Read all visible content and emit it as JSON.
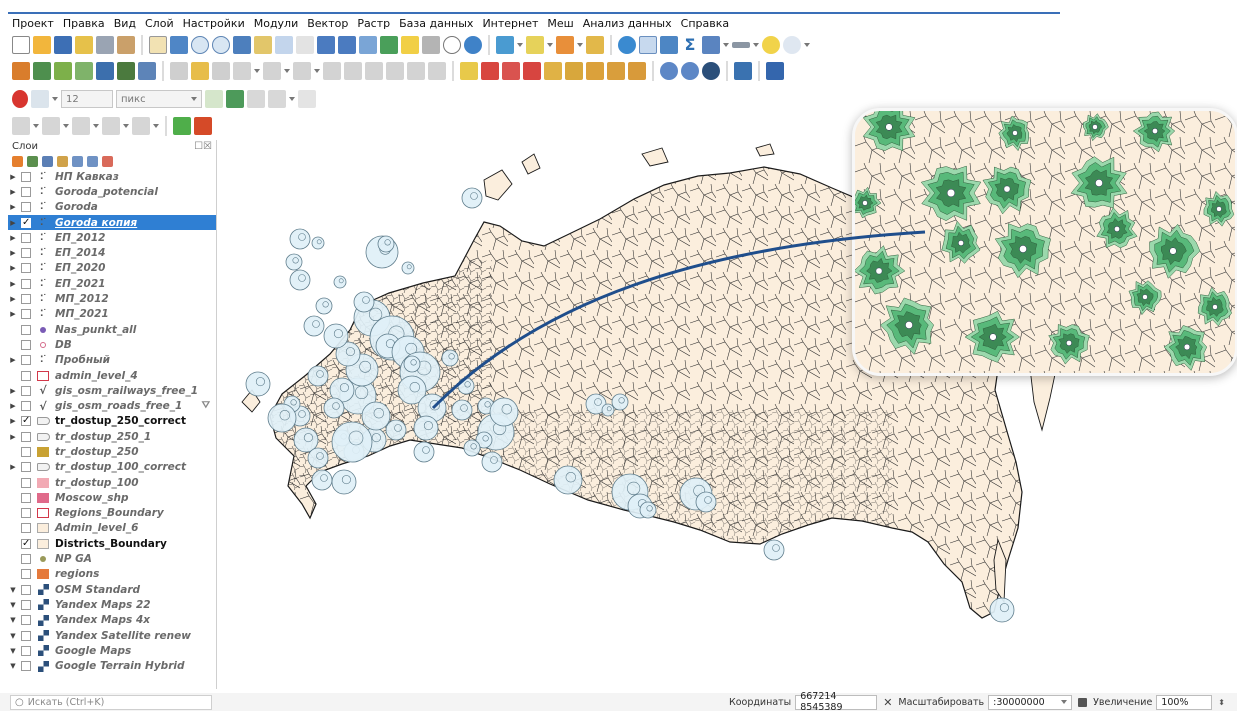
{
  "menu": [
    "Проект",
    "Правка",
    "Вид",
    "Слой",
    "Настройки",
    "Модули",
    "Вектор",
    "Растр",
    "База данных",
    "Интернет",
    "Меш",
    "Анализ данных",
    "Справка"
  ],
  "toolbar": {
    "font_size_value": "12",
    "unit_select": "пикс"
  },
  "layers_panel": {
    "title": "Слои",
    "header_buttons": "☐☒",
    "items": [
      {
        "name": "НП Кавказ",
        "arrow": "▶",
        "check": "",
        "sym": "points",
        "visible": false
      },
      {
        "name": "Goroda_potencial",
        "arrow": "▶",
        "check": "",
        "sym": "points",
        "visible": false
      },
      {
        "name": "Goroda",
        "arrow": "▶",
        "check": "",
        "sym": "points",
        "visible": false
      },
      {
        "name": "Goroda копия",
        "arrow": "▶",
        "check": "✓",
        "sym": "points",
        "visible": true,
        "selected": true
      },
      {
        "name": "ЕП_2012",
        "arrow": "▶",
        "check": "",
        "sym": "points",
        "visible": false
      },
      {
        "name": "ЕП_2014",
        "arrow": "▶",
        "check": "",
        "sym": "points",
        "visible": false
      },
      {
        "name": "ЕП_2020",
        "arrow": "▶",
        "check": "",
        "sym": "points",
        "visible": false
      },
      {
        "name": "ЕП_2021",
        "arrow": "▶",
        "check": "",
        "sym": "points",
        "visible": false
      },
      {
        "name": "МП_2012",
        "arrow": "▶",
        "check": "",
        "sym": "points",
        "visible": false
      },
      {
        "name": "МП_2021",
        "arrow": "▶",
        "check": "",
        "sym": "points",
        "visible": false
      },
      {
        "name": "Nas_punkt_all",
        "arrow": "",
        "check": "",
        "sym": "dot-purple",
        "visible": false
      },
      {
        "name": "DB",
        "arrow": "",
        "check": "",
        "sym": "dot-pink",
        "visible": false
      },
      {
        "name": "Пробный",
        "arrow": "▶",
        "check": "",
        "sym": "points",
        "visible": false
      },
      {
        "name": "admin_level_4",
        "arrow": "",
        "check": "",
        "sym": "box-red-outline",
        "visible": false
      },
      {
        "name": "gis_osm_railways_free_1",
        "arrow": "▶",
        "check": "",
        "sym": "line",
        "visible": false
      },
      {
        "name": "gis_osm_roads_free_1",
        "arrow": "▶",
        "check": "",
        "sym": "line",
        "visible": false,
        "filter": true
      },
      {
        "name": "tr_dostup_250_correct",
        "arrow": "▶",
        "check": "✓",
        "sym": "rule",
        "visible": true
      },
      {
        "name": "tr_dostup_250_1",
        "arrow": "▶",
        "check": "",
        "sym": "rule",
        "visible": false
      },
      {
        "name": "tr_dostup_250",
        "arrow": "",
        "check": "",
        "sym": "box-gold",
        "visible": false
      },
      {
        "name": "tr_dostup_100_correct",
        "arrow": "▶",
        "check": "",
        "sym": "rule",
        "visible": false
      },
      {
        "name": "tr_dostup_100",
        "arrow": "",
        "check": "",
        "sym": "box-pink",
        "visible": false
      },
      {
        "name": "Moscow_shp",
        "arrow": "",
        "check": "",
        "sym": "box-rose",
        "visible": false
      },
      {
        "name": "Regions_Boundary",
        "arrow": "",
        "check": "",
        "sym": "box-red-outline",
        "visible": false
      },
      {
        "name": "Admin_level_6",
        "arrow": "",
        "check": "",
        "sym": "box-cream",
        "visible": false
      },
      {
        "name": "Districts_Boundary",
        "arrow": "",
        "check": "✓",
        "sym": "box-cream",
        "visible": true
      },
      {
        "name": "NP GA",
        "arrow": "",
        "check": "",
        "sym": "dot-olive",
        "visible": false
      },
      {
        "name": "regions",
        "arrow": "",
        "check": "",
        "sym": "box-orange",
        "visible": false
      },
      {
        "name": "OSM Standard",
        "arrow": "▼",
        "check": "",
        "sym": "raster",
        "visible": false
      },
      {
        "name": "Yandex Maps 22",
        "arrow": "▼",
        "check": "",
        "sym": "raster",
        "visible": false
      },
      {
        "name": "Yandex Maps 4x",
        "arrow": "▼",
        "check": "",
        "sym": "raster",
        "visible": false
      },
      {
        "name": "Yandex Satellite renew",
        "arrow": "▼",
        "check": "",
        "sym": "raster",
        "visible": false
      },
      {
        "name": "Google Maps",
        "arrow": "▼",
        "check": "",
        "sym": "raster",
        "visible": false
      },
      {
        "name": "Google Terrain Hybrid",
        "arrow": "▼",
        "check": "",
        "sym": "raster",
        "visible": false
      }
    ]
  },
  "status": {
    "search_placeholder": "Искать (Ctrl+K)",
    "coord_label": "Координаты",
    "coord_value": "667214 8545389",
    "scale_label": "Масштабировать",
    "scale_value": ":30000000",
    "magnifier_label": "Увеличение",
    "magnifier_value": "100%"
  },
  "colors": {
    "land": "#fbeedd",
    "border": "#1a1a1a",
    "circle_fill": "#dff0f7",
    "circle_stroke": "#5f7d8c",
    "arc": "#1f4e8c",
    "selected": "#2f7fd3",
    "access_dark": "#3c8a55",
    "access_mid": "#58b97a",
    "access_light": "#9bd8ac"
  }
}
